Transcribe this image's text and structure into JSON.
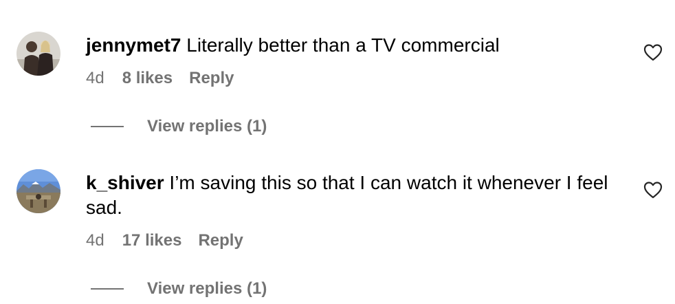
{
  "comments": [
    {
      "username": "jennymet7",
      "text": "Literally better than a TV commercial",
      "time": "4d",
      "likes": "8 likes",
      "reply_label": "Reply",
      "view_replies": "View replies (1)",
      "avatar_icon": "user-avatar-photo",
      "like_icon": "heart-outline-icon"
    },
    {
      "username": "k_shiver",
      "text": "I’m saving this so that I can watch it whenever I feel sad.",
      "time": "4d",
      "likes": "17 likes",
      "reply_label": "Reply",
      "view_replies": "View replies (1)",
      "avatar_icon": "user-avatar-photo",
      "like_icon": "heart-outline-icon"
    }
  ],
  "colors": {
    "text": "#000000",
    "secondary": "#737373",
    "background": "#ffffff"
  }
}
